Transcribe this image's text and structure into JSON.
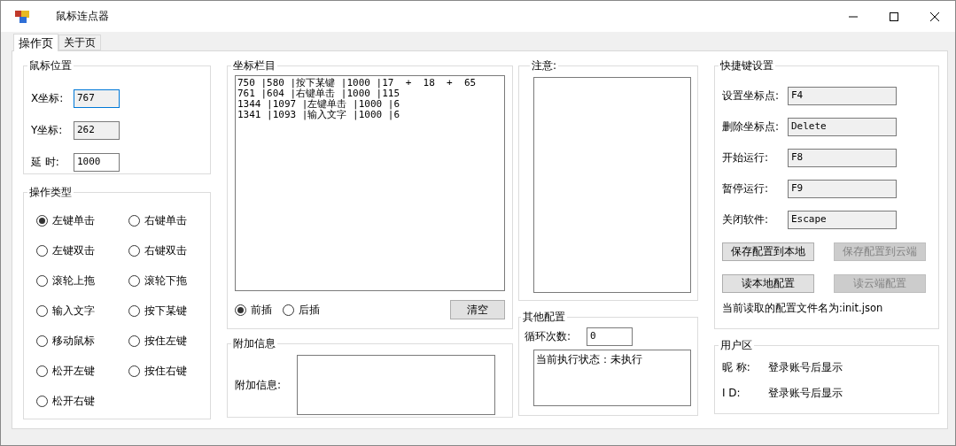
{
  "window": {
    "title": "鼠标连点器"
  },
  "tabs": [
    {
      "label": "操作页",
      "selected": true
    },
    {
      "label": "关于页",
      "selected": false
    }
  ],
  "mouse_position": {
    "title": "鼠标位置",
    "fields": [
      {
        "label": "X坐标:",
        "value": "767",
        "readonly": true,
        "focused": true
      },
      {
        "label": "Y坐标:",
        "value": "262",
        "readonly": true,
        "focused": false
      },
      {
        "label": "延 时:",
        "value": "1000",
        "readonly": false,
        "focused": false
      }
    ]
  },
  "operation_type": {
    "title": "操作类型",
    "options": [
      {
        "label": "左键单击",
        "selected": true
      },
      {
        "label": "右键单击",
        "selected": false
      },
      {
        "label": "左键双击",
        "selected": false
      },
      {
        "label": "右键双击",
        "selected": false
      },
      {
        "label": "滚轮上拖",
        "selected": false
      },
      {
        "label": "滚轮下拖",
        "selected": false
      },
      {
        "label": "输入文字",
        "selected": false
      },
      {
        "label": "按下某键",
        "selected": false
      },
      {
        "label": "移动鼠标",
        "selected": false
      },
      {
        "label": "按住左键",
        "selected": false
      },
      {
        "label": "松开左键",
        "selected": false
      },
      {
        "label": "按住右键",
        "selected": false
      },
      {
        "label": "松开右键",
        "selected": false
      }
    ]
  },
  "coordinate_list": {
    "title": "坐标栏目",
    "lines": [
      "750 |580 |按下某键 |1000 |17  +  18  +  65",
      "761 |604 |右键单击 |1000 |115",
      "1344 |1097 |左键单击 |1000 |6",
      "1341 |1093 |输入文字 |1000 |6"
    ],
    "insert_modes": [
      {
        "label": "前插",
        "selected": true
      },
      {
        "label": "后插",
        "selected": false
      }
    ],
    "clear_button": "清空"
  },
  "extra_info": {
    "title": "附加信息",
    "label": "附加信息:"
  },
  "notes": {
    "title": "注意:"
  },
  "other_config": {
    "title": "其他配置",
    "loop_label": "循环次数:",
    "loop_value": "0",
    "status": "当前执行状态：未执行"
  },
  "hotkeys": {
    "title": "快捷键设置",
    "rows": [
      {
        "label": "设置坐标点:",
        "value": "F4"
      },
      {
        "label": "删除坐标点:",
        "value": "Delete"
      },
      {
        "label": "开始运行:",
        "value": "F8"
      },
      {
        "label": "暂停运行:",
        "value": "F9"
      },
      {
        "label": "关闭软件:",
        "value": "Escape"
      }
    ],
    "buttons": [
      {
        "label": "保存配置到本地",
        "disabled": false
      },
      {
        "label": "保存配置到云端",
        "disabled": true
      },
      {
        "label": "读本地配置",
        "disabled": false
      },
      {
        "label": "读云端配置",
        "disabled": true
      }
    ],
    "config_file": "当前读取的配置文件名为:init.json"
  },
  "user_area": {
    "title": "用户区",
    "rows": [
      {
        "label": "昵 称:",
        "value": "登录账号后显示"
      },
      {
        "label": "I D:",
        "value": "登录账号后显示"
      }
    ]
  }
}
